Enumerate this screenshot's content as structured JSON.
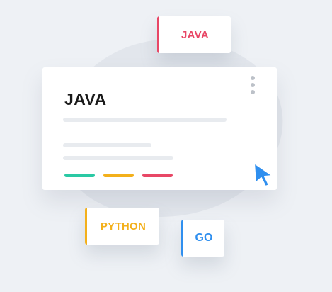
{
  "tags": {
    "java": "JAVA",
    "python": "PYTHON",
    "go": "GO"
  },
  "card": {
    "title": "JAVA",
    "status_colors": [
      "#2ac9a4",
      "#f3b01b",
      "#e84766"
    ]
  },
  "colors": {
    "java": "#e84766",
    "python": "#f3b01b",
    "go": "#2f8fef",
    "cursor": "#2f8fef"
  },
  "icons": {
    "menu": "kebab-menu-icon",
    "cursor": "mouse-pointer-icon"
  }
}
